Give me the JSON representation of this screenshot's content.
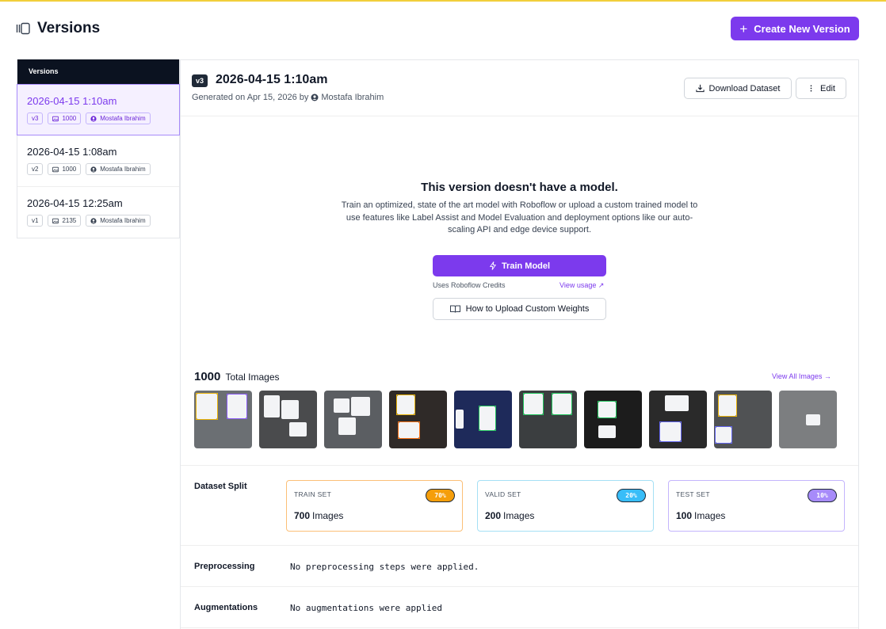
{
  "header": {
    "title": "Versions",
    "create_button": "Create New Version"
  },
  "colors": {
    "accent": "#7c3aed",
    "train": "#f59e0b",
    "valid": "#38bdf8",
    "test": "#a78bfa"
  },
  "sidebar": {
    "heading": "Versions",
    "items": [
      {
        "title": "2026-04-15 1:10am",
        "version": "v3",
        "images": "1000",
        "author": "Mostafa Ibrahim",
        "active": true
      },
      {
        "title": "2026-04-15 1:08am",
        "version": "v2",
        "images": "1000",
        "author": "Mostafa Ibrahim",
        "active": false
      },
      {
        "title": "2026-04-15 12:25am",
        "version": "v1",
        "images": "2135",
        "author": "Mostafa Ibrahim",
        "active": false
      }
    ]
  },
  "version": {
    "badge": "v3",
    "title": "2026-04-15 1:10am",
    "generated_prefix": "Generated on Apr 15, 2026 by",
    "author": "Mostafa Ibrahim",
    "download_button": "Download Dataset",
    "edit_button": "Edit"
  },
  "model": {
    "title": "This version doesn't have a model.",
    "description": "Train an optimized, state of the art model with Roboflow or upload a custom trained model to use features like Label Assist and Model Evaluation and deployment options like our auto-scaling API and edge device support.",
    "train_button": "Train Model",
    "credits_note": "Uses Roboflow Credits",
    "view_usage": "View usage ↗",
    "upload_button": "How to Upload Custom Weights"
  },
  "images": {
    "count": "1000",
    "label": "Total Images",
    "view_all": "View All Images →"
  },
  "split": {
    "label": "Dataset Split",
    "train": {
      "name": "TRAIN SET",
      "percent": "70%",
      "count": "700",
      "unit": "Images"
    },
    "valid": {
      "name": "VALID SET",
      "percent": "20%",
      "count": "200",
      "unit": "Images"
    },
    "test": {
      "name": "TEST SET",
      "percent": "10%",
      "count": "100",
      "unit": "Images"
    }
  },
  "preprocessing": {
    "label": "Preprocessing",
    "value": "No preprocessing steps were applied."
  },
  "augmentations": {
    "label": "Augmentations",
    "value": "No augmentations were applied"
  }
}
